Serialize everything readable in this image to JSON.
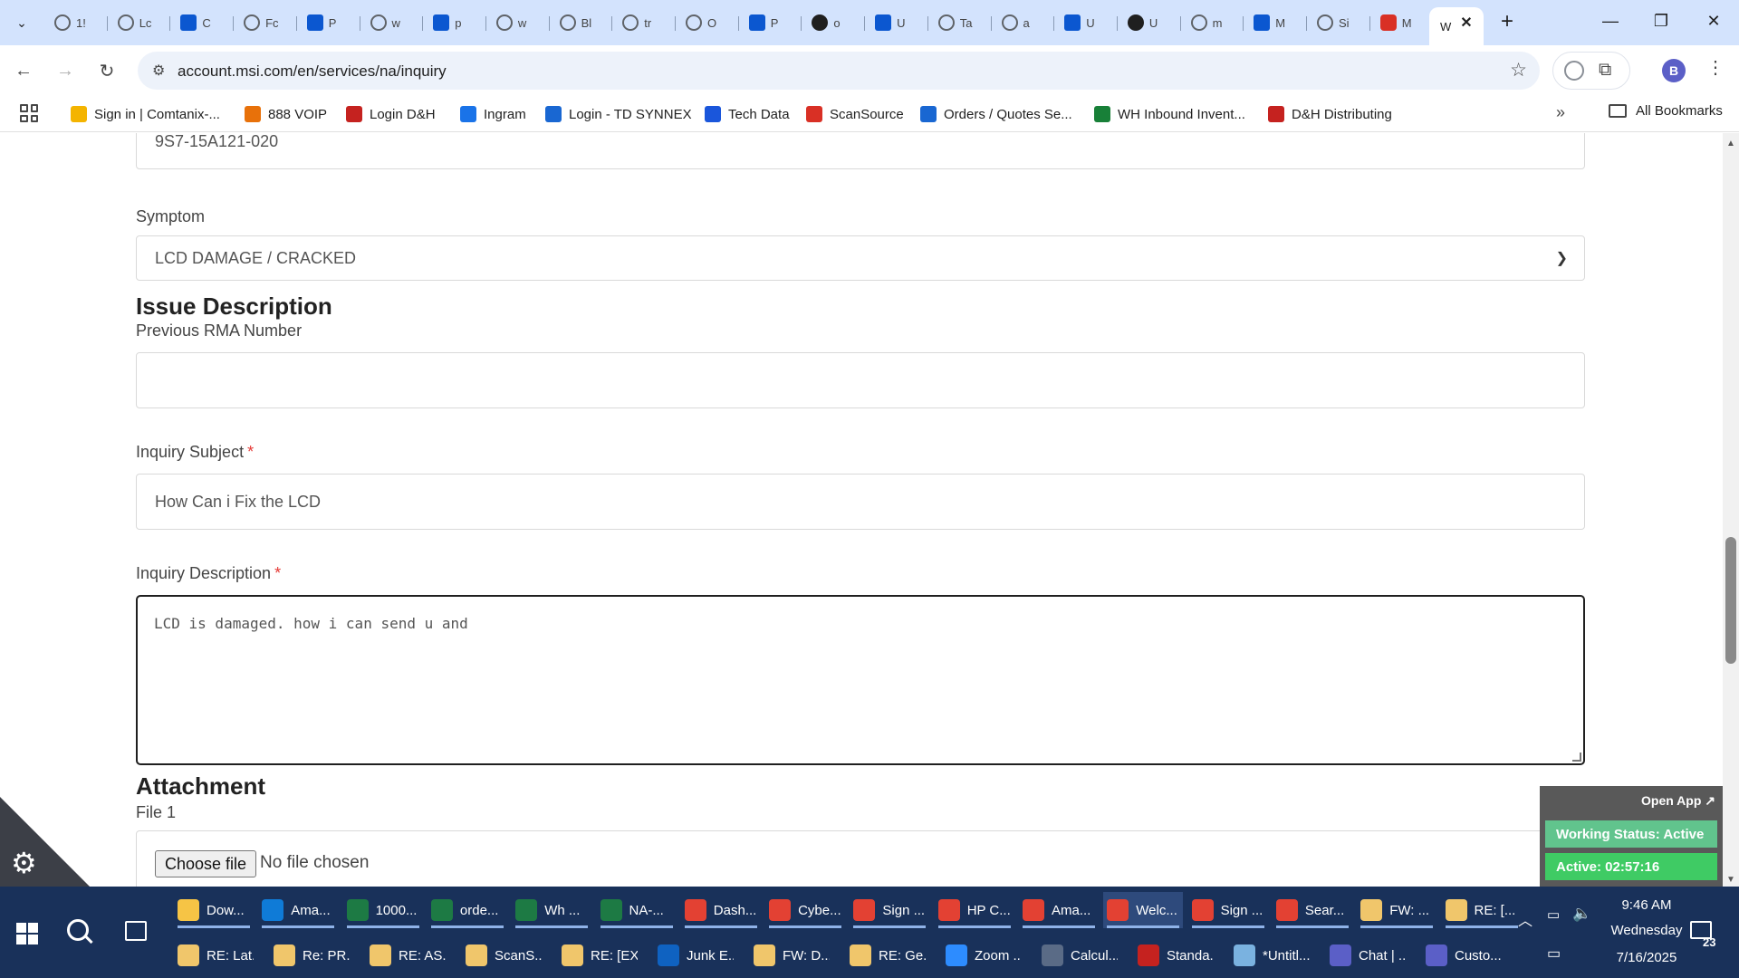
{
  "browser": {
    "tabs": [
      {
        "label": "1!"
      },
      {
        "label": "Lc"
      },
      {
        "label": "C"
      },
      {
        "label": "Fc"
      },
      {
        "label": "P"
      },
      {
        "label": "w"
      },
      {
        "label": "p"
      },
      {
        "label": "w"
      },
      {
        "label": "Bl"
      },
      {
        "label": "tr"
      },
      {
        "label": "O"
      },
      {
        "label": "P"
      },
      {
        "label": "o"
      },
      {
        "label": "U"
      },
      {
        "label": "Ta"
      },
      {
        "label": "a"
      },
      {
        "label": "U"
      },
      {
        "label": "U"
      },
      {
        "label": "m"
      },
      {
        "label": "M"
      },
      {
        "label": "Si"
      },
      {
        "label": "M"
      }
    ],
    "active_tab": {
      "label": "W"
    },
    "url": "account.msi.com/en/services/na/inquiry",
    "profile_initial": "B",
    "bookmarks": [
      {
        "label": "Sign in | Comtanix-...",
        "color": "#f4b400"
      },
      {
        "label": "888 VOIP",
        "color": "#e8710a"
      },
      {
        "label": "Login D&H",
        "color": "#c5221f"
      },
      {
        "label": "Ingram",
        "color": "#1a73e8"
      },
      {
        "label": "Login - TD SYNNEX",
        "color": "#1967d2"
      },
      {
        "label": "Tech Data",
        "color": "#1a56db"
      },
      {
        "label": "ScanSource",
        "color": "#d93025"
      },
      {
        "label": "Orders / Quotes Se...",
        "color": "#1967d2"
      },
      {
        "label": "WH Inbound Invent...",
        "color": "#188038"
      },
      {
        "label": "D&H Distributing",
        "color": "#c5221f"
      }
    ],
    "all_bookmarks": "All Bookmarks"
  },
  "form": {
    "serial_value": "9S7-15A121-020",
    "symptom_label": "Symptom",
    "symptom_value": "LCD DAMAGE / CRACKED",
    "issue_title": "Issue Description",
    "prev_rma_label": "Previous RMA Number",
    "prev_rma_value": "",
    "subject_label": "Inquiry Subject",
    "subject_value": "How Can i Fix the LCD",
    "description_label": "Inquiry Description",
    "description_value": "LCD is damaged. how i can send u and",
    "required_mark": "*",
    "attachment_title": "Attachment",
    "file1_label": "File 1",
    "choose_file": "Choose file",
    "no_file": "No file chosen"
  },
  "widget": {
    "open_app": "Open App ↗",
    "working_status": "Working Status: Active",
    "active_timer": "Active: 02:57:16"
  },
  "taskbar": {
    "row1": [
      {
        "label": "Dow...",
        "color": "#f6c445"
      },
      {
        "label": "Ama...",
        "color": "#0f7bd7"
      },
      {
        "label": "1000...",
        "color": "#1d7a44"
      },
      {
        "label": "orde...",
        "color": "#1d7a44"
      },
      {
        "label": "Wh ...",
        "color": "#1d7a44"
      },
      {
        "label": "NA-...",
        "color": "#1d7a44"
      },
      {
        "label": "Dash...",
        "color": "#e34133"
      },
      {
        "label": "Cybe...",
        "color": "#e34133"
      },
      {
        "label": "Sign ...",
        "color": "#e34133"
      },
      {
        "label": "HP C...",
        "color": "#e34133"
      },
      {
        "label": "Ama...",
        "color": "#e34133"
      },
      {
        "label": "Welc...",
        "color": "#e34133"
      },
      {
        "label": "Sign ...",
        "color": "#e34133"
      },
      {
        "label": "Sear...",
        "color": "#e34133"
      },
      {
        "label": "FW: ...",
        "color": "#f0c66b"
      },
      {
        "label": "RE: [...",
        "color": "#f0c66b"
      }
    ],
    "row2": [
      {
        "label": "RE: Lat...",
        "color": "#f0c66b"
      },
      {
        "label": "Re: PR...",
        "color": "#f0c66b"
      },
      {
        "label": "RE: AS...",
        "color": "#f0c66b"
      },
      {
        "label": "ScanS...",
        "color": "#f0c66b"
      },
      {
        "label": "RE: [EX...",
        "color": "#f0c66b"
      },
      {
        "label": "Junk E...",
        "color": "#0f62c1"
      },
      {
        "label": "FW: D...",
        "color": "#f0c66b"
      },
      {
        "label": "RE: Ge...",
        "color": "#f0c66b"
      },
      {
        "label": "Zoom ...",
        "color": "#2d8cff"
      },
      {
        "label": "Calcul...",
        "color": "#5a6b86"
      },
      {
        "label": "Standa...",
        "color": "#c5221f"
      },
      {
        "label": "*Untitl...",
        "color": "#7ab2e0"
      },
      {
        "label": "Chat | ...",
        "color": "#5b5fc7"
      },
      {
        "label": "Custo...",
        "color": "#5b5fc7"
      }
    ],
    "time": "9:46 AM",
    "day": "Wednesday",
    "date": "7/16/2025",
    "notification_count": "23"
  }
}
